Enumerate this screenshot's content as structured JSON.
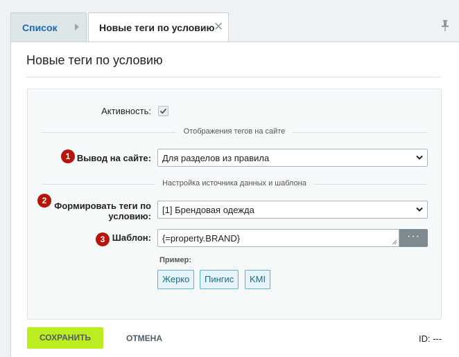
{
  "tabs": {
    "list_label": "Список",
    "active_label": "Новые теги по условию"
  },
  "page": {
    "title": "Новые теги по условию"
  },
  "form": {
    "active_label": "Активность:",
    "active_checked": true,
    "section1": "Отображения тегов на сайте",
    "output_label": "Вывод на сайте:",
    "output_value": "Для разделов из правила",
    "section2": "Настройка источника данных и шаблона",
    "condition_label_line1": "Формировать теги по",
    "condition_label_line2": "условию:",
    "condition_value": "[1] Брендовая одежда",
    "template_label": "Шаблон:",
    "template_value": "{=property.BRAND}",
    "template_button": "···",
    "example_label": "Пример:",
    "examples": [
      "Жерко",
      "Пингис",
      "KMI"
    ]
  },
  "badges": [
    "1",
    "2",
    "3"
  ],
  "footer": {
    "save": "СОХРАНИТЬ",
    "cancel": "ОТМЕНА",
    "id": "ID: ---"
  },
  "colors": {
    "link": "#2067b0",
    "badge": "#b7140c",
    "save_bg": "#bbed21",
    "chip_border": "#5fb0d0"
  }
}
